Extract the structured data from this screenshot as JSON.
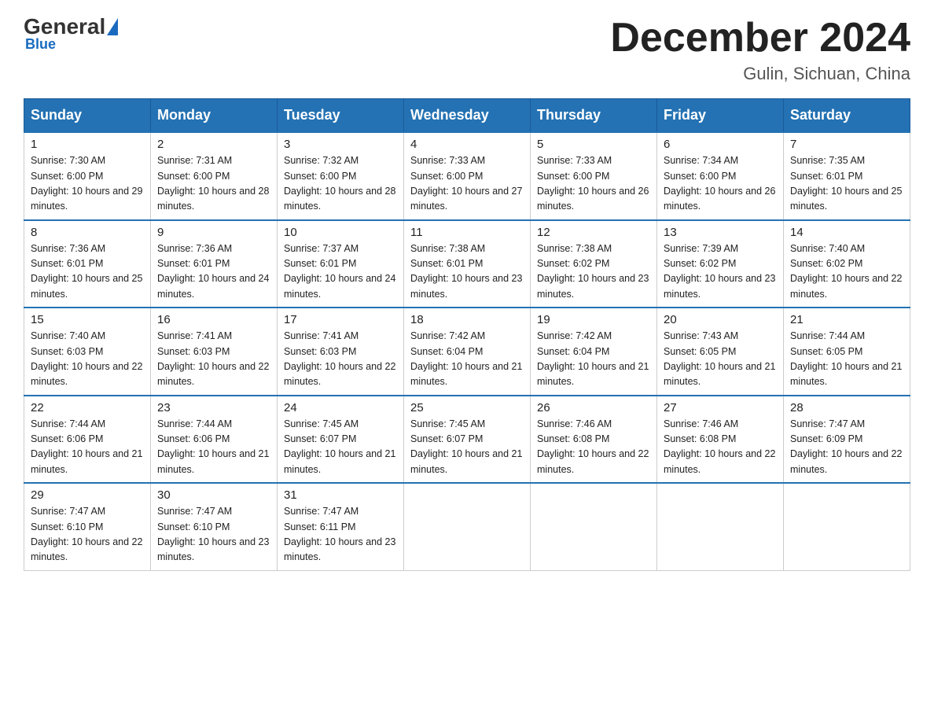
{
  "logo": {
    "general": "General",
    "blue": "Blue"
  },
  "header": {
    "month": "December 2024",
    "location": "Gulin, Sichuan, China"
  },
  "weekdays": [
    "Sunday",
    "Monday",
    "Tuesday",
    "Wednesday",
    "Thursday",
    "Friday",
    "Saturday"
  ],
  "weeks": [
    [
      {
        "day": "1",
        "sunrise": "7:30 AM",
        "sunset": "6:00 PM",
        "daylight": "10 hours and 29 minutes."
      },
      {
        "day": "2",
        "sunrise": "7:31 AM",
        "sunset": "6:00 PM",
        "daylight": "10 hours and 28 minutes."
      },
      {
        "day": "3",
        "sunrise": "7:32 AM",
        "sunset": "6:00 PM",
        "daylight": "10 hours and 28 minutes."
      },
      {
        "day": "4",
        "sunrise": "7:33 AM",
        "sunset": "6:00 PM",
        "daylight": "10 hours and 27 minutes."
      },
      {
        "day": "5",
        "sunrise": "7:33 AM",
        "sunset": "6:00 PM",
        "daylight": "10 hours and 26 minutes."
      },
      {
        "day": "6",
        "sunrise": "7:34 AM",
        "sunset": "6:00 PM",
        "daylight": "10 hours and 26 minutes."
      },
      {
        "day": "7",
        "sunrise": "7:35 AM",
        "sunset": "6:01 PM",
        "daylight": "10 hours and 25 minutes."
      }
    ],
    [
      {
        "day": "8",
        "sunrise": "7:36 AM",
        "sunset": "6:01 PM",
        "daylight": "10 hours and 25 minutes."
      },
      {
        "day": "9",
        "sunrise": "7:36 AM",
        "sunset": "6:01 PM",
        "daylight": "10 hours and 24 minutes."
      },
      {
        "day": "10",
        "sunrise": "7:37 AM",
        "sunset": "6:01 PM",
        "daylight": "10 hours and 24 minutes."
      },
      {
        "day": "11",
        "sunrise": "7:38 AM",
        "sunset": "6:01 PM",
        "daylight": "10 hours and 23 minutes."
      },
      {
        "day": "12",
        "sunrise": "7:38 AM",
        "sunset": "6:02 PM",
        "daylight": "10 hours and 23 minutes."
      },
      {
        "day": "13",
        "sunrise": "7:39 AM",
        "sunset": "6:02 PM",
        "daylight": "10 hours and 23 minutes."
      },
      {
        "day": "14",
        "sunrise": "7:40 AM",
        "sunset": "6:02 PM",
        "daylight": "10 hours and 22 minutes."
      }
    ],
    [
      {
        "day": "15",
        "sunrise": "7:40 AM",
        "sunset": "6:03 PM",
        "daylight": "10 hours and 22 minutes."
      },
      {
        "day": "16",
        "sunrise": "7:41 AM",
        "sunset": "6:03 PM",
        "daylight": "10 hours and 22 minutes."
      },
      {
        "day": "17",
        "sunrise": "7:41 AM",
        "sunset": "6:03 PM",
        "daylight": "10 hours and 22 minutes."
      },
      {
        "day": "18",
        "sunrise": "7:42 AM",
        "sunset": "6:04 PM",
        "daylight": "10 hours and 21 minutes."
      },
      {
        "day": "19",
        "sunrise": "7:42 AM",
        "sunset": "6:04 PM",
        "daylight": "10 hours and 21 minutes."
      },
      {
        "day": "20",
        "sunrise": "7:43 AM",
        "sunset": "6:05 PM",
        "daylight": "10 hours and 21 minutes."
      },
      {
        "day": "21",
        "sunrise": "7:44 AM",
        "sunset": "6:05 PM",
        "daylight": "10 hours and 21 minutes."
      }
    ],
    [
      {
        "day": "22",
        "sunrise": "7:44 AM",
        "sunset": "6:06 PM",
        "daylight": "10 hours and 21 minutes."
      },
      {
        "day": "23",
        "sunrise": "7:44 AM",
        "sunset": "6:06 PM",
        "daylight": "10 hours and 21 minutes."
      },
      {
        "day": "24",
        "sunrise": "7:45 AM",
        "sunset": "6:07 PM",
        "daylight": "10 hours and 21 minutes."
      },
      {
        "day": "25",
        "sunrise": "7:45 AM",
        "sunset": "6:07 PM",
        "daylight": "10 hours and 21 minutes."
      },
      {
        "day": "26",
        "sunrise": "7:46 AM",
        "sunset": "6:08 PM",
        "daylight": "10 hours and 22 minutes."
      },
      {
        "day": "27",
        "sunrise": "7:46 AM",
        "sunset": "6:08 PM",
        "daylight": "10 hours and 22 minutes."
      },
      {
        "day": "28",
        "sunrise": "7:47 AM",
        "sunset": "6:09 PM",
        "daylight": "10 hours and 22 minutes."
      }
    ],
    [
      {
        "day": "29",
        "sunrise": "7:47 AM",
        "sunset": "6:10 PM",
        "daylight": "10 hours and 22 minutes."
      },
      {
        "day": "30",
        "sunrise": "7:47 AM",
        "sunset": "6:10 PM",
        "daylight": "10 hours and 23 minutes."
      },
      {
        "day": "31",
        "sunrise": "7:47 AM",
        "sunset": "6:11 PM",
        "daylight": "10 hours and 23 minutes."
      },
      null,
      null,
      null,
      null
    ]
  ]
}
